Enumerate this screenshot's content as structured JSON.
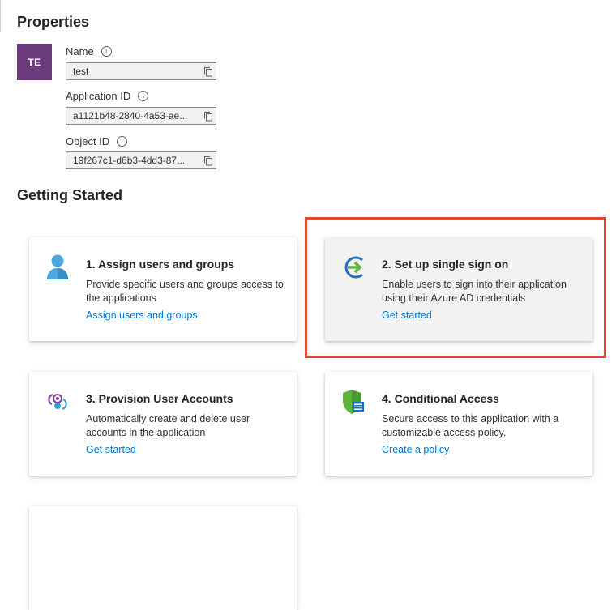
{
  "properties": {
    "title": "Properties",
    "avatar_initials": "TE",
    "fields": [
      {
        "label": "Name",
        "value": "test"
      },
      {
        "label": "Application ID",
        "value": "a1121b48-2840-4a53-ae..."
      },
      {
        "label": "Object ID",
        "value": "19f267c1-d6b3-4dd3-87..."
      }
    ]
  },
  "getting_started": {
    "title": "Getting Started",
    "cards": [
      {
        "title": "1. Assign users and groups",
        "description": "Provide specific users and groups access to the applications",
        "link": "Assign users and groups"
      },
      {
        "title": "2. Set up single sign on",
        "description": "Enable users to sign into their application using their Azure AD credentials",
        "link": "Get started"
      },
      {
        "title": "3. Provision User Accounts",
        "description": "Automatically create and delete user accounts in the application",
        "link": "Get started"
      },
      {
        "title": "4. Conditional Access",
        "description": "Secure access to this application with a customizable access policy.",
        "link": "Create a policy"
      }
    ]
  },
  "colors": {
    "avatar": "#6b3a7d",
    "link": "#0078d4",
    "highlight": "#e8442f",
    "card_highlighted_bg": "#f3f2f1"
  },
  "icons": [
    "info-icon",
    "copy-icon",
    "user-icon",
    "sign-in-arrow-icon",
    "provisioning-icon",
    "shield-policy-icon"
  ]
}
